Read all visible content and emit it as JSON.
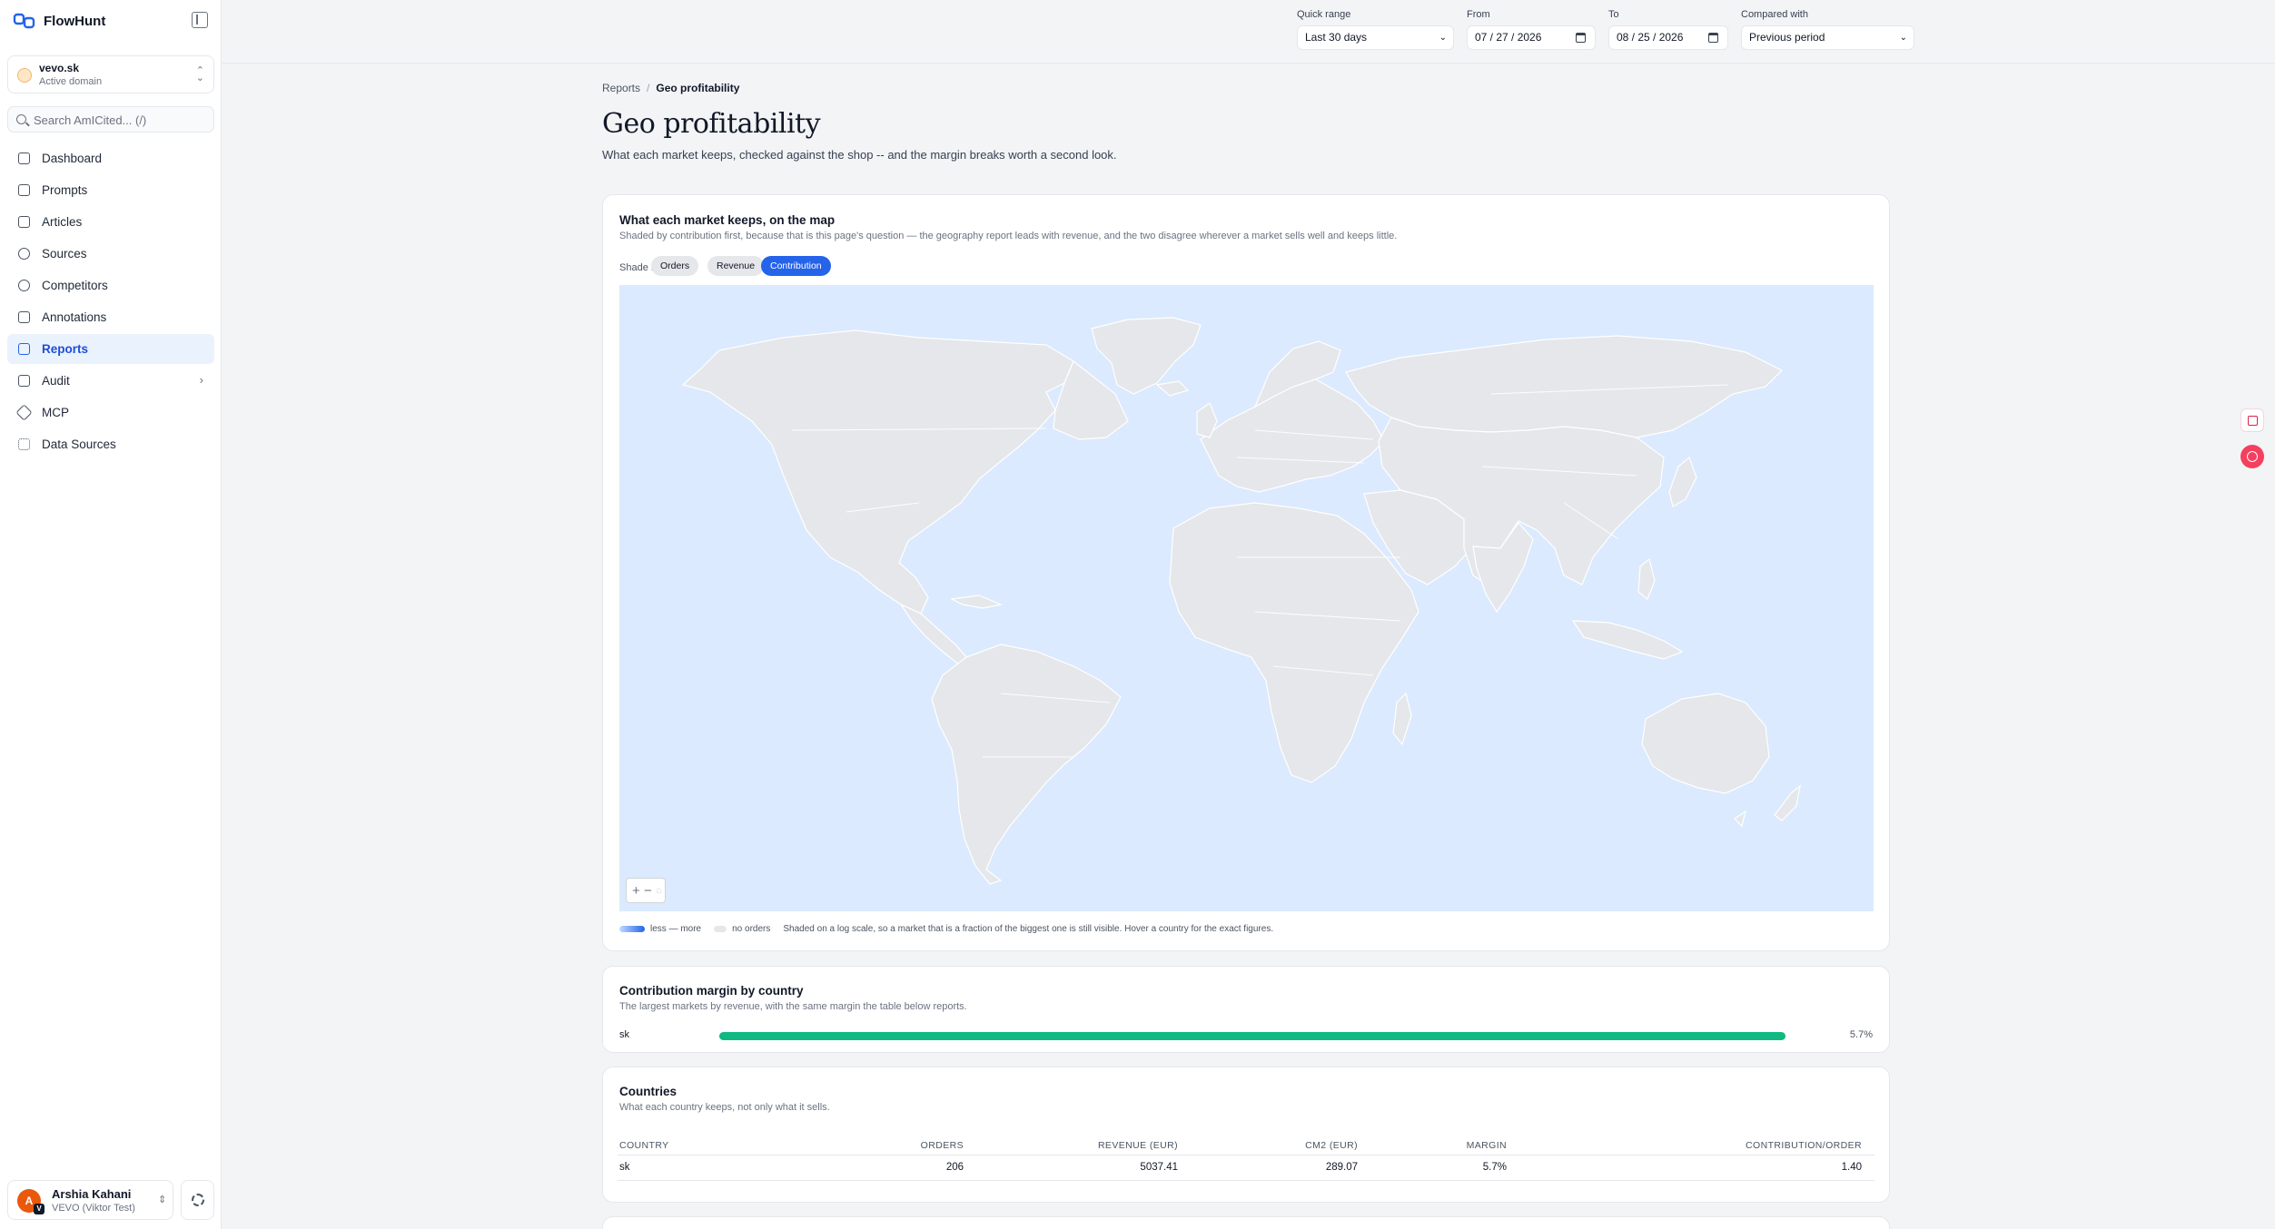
{
  "app": {
    "name": "FlowHunt"
  },
  "domain": {
    "name": "vevo.sk",
    "subtitle": "Active domain"
  },
  "search": {
    "placeholder": "Search AmICited... (/)"
  },
  "sidebar": {
    "items": [
      {
        "label": "Dashboard",
        "icon": "dashboard-icon"
      },
      {
        "label": "Prompts",
        "icon": "prompts-icon"
      },
      {
        "label": "Articles",
        "icon": "articles-icon"
      },
      {
        "label": "Sources",
        "icon": "sources-icon"
      },
      {
        "label": "Competitors",
        "icon": "competitors-icon"
      },
      {
        "label": "Annotations",
        "icon": "annotations-icon"
      },
      {
        "label": "Reports",
        "icon": "reports-icon",
        "active": true
      },
      {
        "label": "Audit",
        "icon": "audit-icon",
        "expandable": true
      },
      {
        "label": "MCP",
        "icon": "mcp-icon"
      },
      {
        "label": "Data Sources",
        "icon": "data-sources-icon"
      }
    ]
  },
  "user": {
    "initial": "A",
    "badge": "V",
    "name": "Arshia Kahani",
    "org": "VEVO (Viktor Test)"
  },
  "filters": {
    "quick_range": {
      "label": "Quick range",
      "value": "Last 30 days"
    },
    "from": {
      "label": "From",
      "value": "07 / 27 / 2026"
    },
    "to": {
      "label": "To",
      "value": "08 / 25 / 2026"
    },
    "compared_with": {
      "label": "Compared with",
      "value": "Previous period"
    }
  },
  "breadcrumb": {
    "parent": "Reports",
    "separator": "/",
    "current": "Geo profitability"
  },
  "page": {
    "title": "Geo profitability",
    "subtitle": "What each market keeps, checked against the shop -- and the margin breaks worth a second look."
  },
  "map_card": {
    "title": "What each market keeps, on the map",
    "subtitle": "Shaded by contribution first, because that is this page's question — the geography report leads with revenue, and the two disagree wherever a market sells well and keeps little.",
    "shade_by_label": "Shade by",
    "shade_options": [
      "Orders",
      "Revenue",
      "Contribution"
    ],
    "active_option": "Contribution",
    "colors": {
      "ocean": "#dbeafe",
      "land": "#e5e7eb",
      "border": "#ffffff",
      "active_chip": "#2563eb"
    },
    "zoom": {
      "in": "+",
      "out": "−",
      "reset": "⌂"
    },
    "legend": {
      "scale": "less — more",
      "no_orders": "no orders",
      "note": "Shaded on a log scale, so a market that is a fraction of the biggest one is still visible. Hover a country for the exact figures."
    }
  },
  "margin_card": {
    "title": "Contribution margin by country",
    "subtitle": "The largest markets by revenue, with the same margin the table below reports.",
    "rows": [
      {
        "country": "sk",
        "margin": "5.7%",
        "fill_fraction": 1.0
      }
    ],
    "bar_color": "#10b981"
  },
  "countries_card": {
    "title": "Countries",
    "subtitle": "What each country keeps, not only what it sells.",
    "columns": [
      "COUNTRY",
      "ORDERS",
      "REVENUE (EUR)",
      "CM2 (EUR)",
      "MARGIN",
      "CONTRIBUTION/ORDER"
    ],
    "rows": [
      [
        "sk",
        "206",
        "5037.41",
        "289.07",
        "5.7%",
        "1.40"
      ]
    ]
  }
}
